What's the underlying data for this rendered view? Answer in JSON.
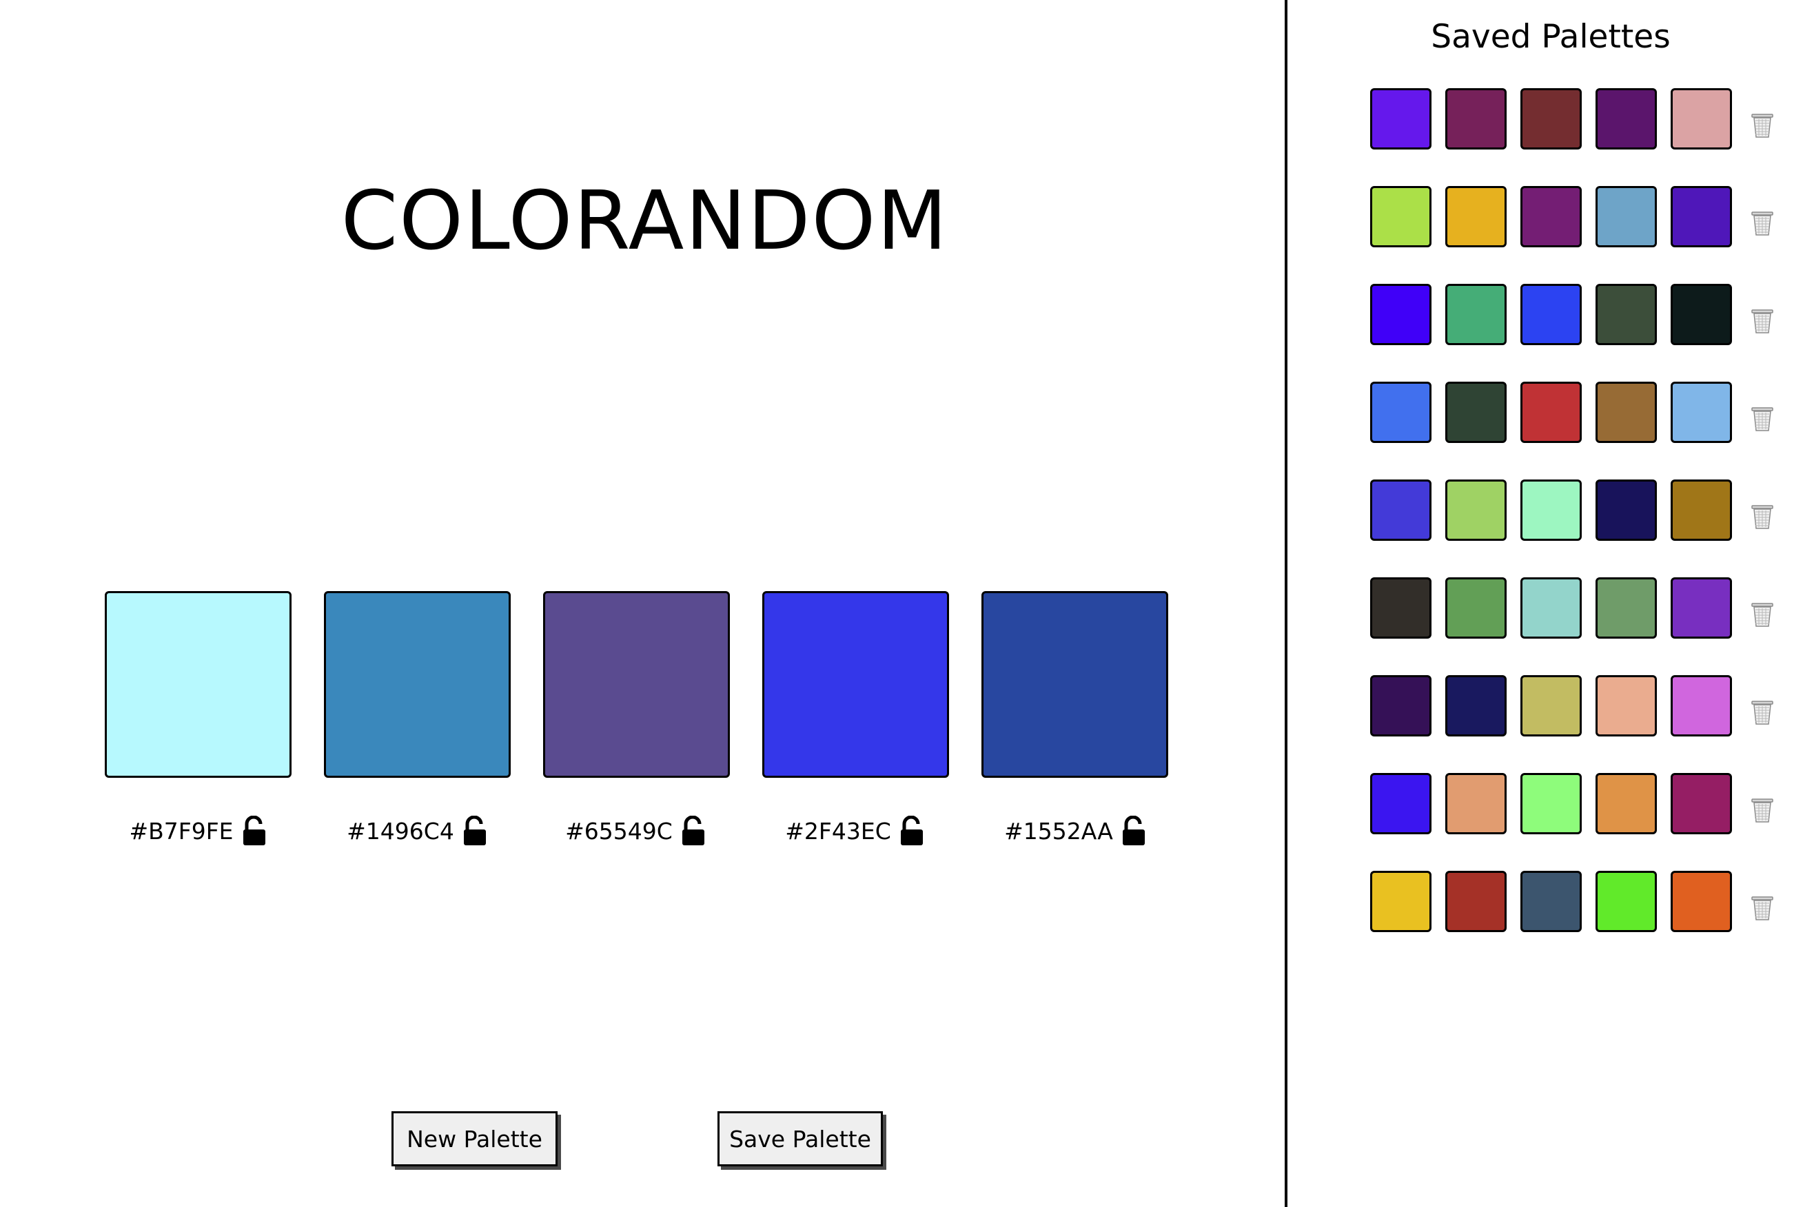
{
  "app": {
    "title": "COLORANDOM"
  },
  "current_palette": [
    {
      "hex": "#B7F9FE",
      "color": "#B7F9FE",
      "lock_icon": "unlocked-padlock-icon"
    },
    {
      "hex": "#1496C4",
      "color": "#3A88BC",
      "lock_icon": "unlocked-padlock-icon"
    },
    {
      "hex": "#65549C",
      "color": "#5A4B90",
      "lock_icon": "unlocked-padlock-icon"
    },
    {
      "hex": "#2F43EC",
      "color": "#3437EA",
      "lock_icon": "unlocked-padlock-icon"
    },
    {
      "hex": "#1552AA",
      "color": "#2847A0",
      "lock_icon": "unlocked-padlock-icon"
    }
  ],
  "buttons": {
    "new_palette": "New Palette",
    "save_palette": "Save Palette"
  },
  "sidebar": {
    "title": "Saved Palettes",
    "delete_icon": "trash-can-icon",
    "palettes": [
      [
        "#6518EC",
        "#76215A",
        "#742D30",
        "#5B156C",
        "#DBA3A4"
      ],
      [
        "#ABE048",
        "#E6B11F",
        "#741E74",
        "#6EA4C8",
        "#4F17B9"
      ],
      [
        "#4000F8",
        "#45AD77",
        "#2C43F2",
        "#3C4E3A",
        "#0D1B1B"
      ],
      [
        "#4170EE",
        "#2F4434",
        "#C03235",
        "#976B35",
        "#80B6E8"
      ],
      [
        "#433AD8",
        "#9FD264",
        "#9DF6C1",
        "#18135B",
        "#A07618"
      ],
      [
        "#322E29",
        "#629F56",
        "#93D4CB",
        "#6F9C69",
        "#782FC0"
      ],
      [
        "#351157",
        "#19195F",
        "#C2BC62",
        "#EAAC8F",
        "#D066DE"
      ],
      [
        "#3B15F0",
        "#E19C70",
        "#8EFC7B",
        "#DF9347",
        "#951E64"
      ],
      [
        "#E9C121",
        "#A53127",
        "#3C556E",
        "#61EA2A",
        "#E06020"
      ]
    ]
  }
}
